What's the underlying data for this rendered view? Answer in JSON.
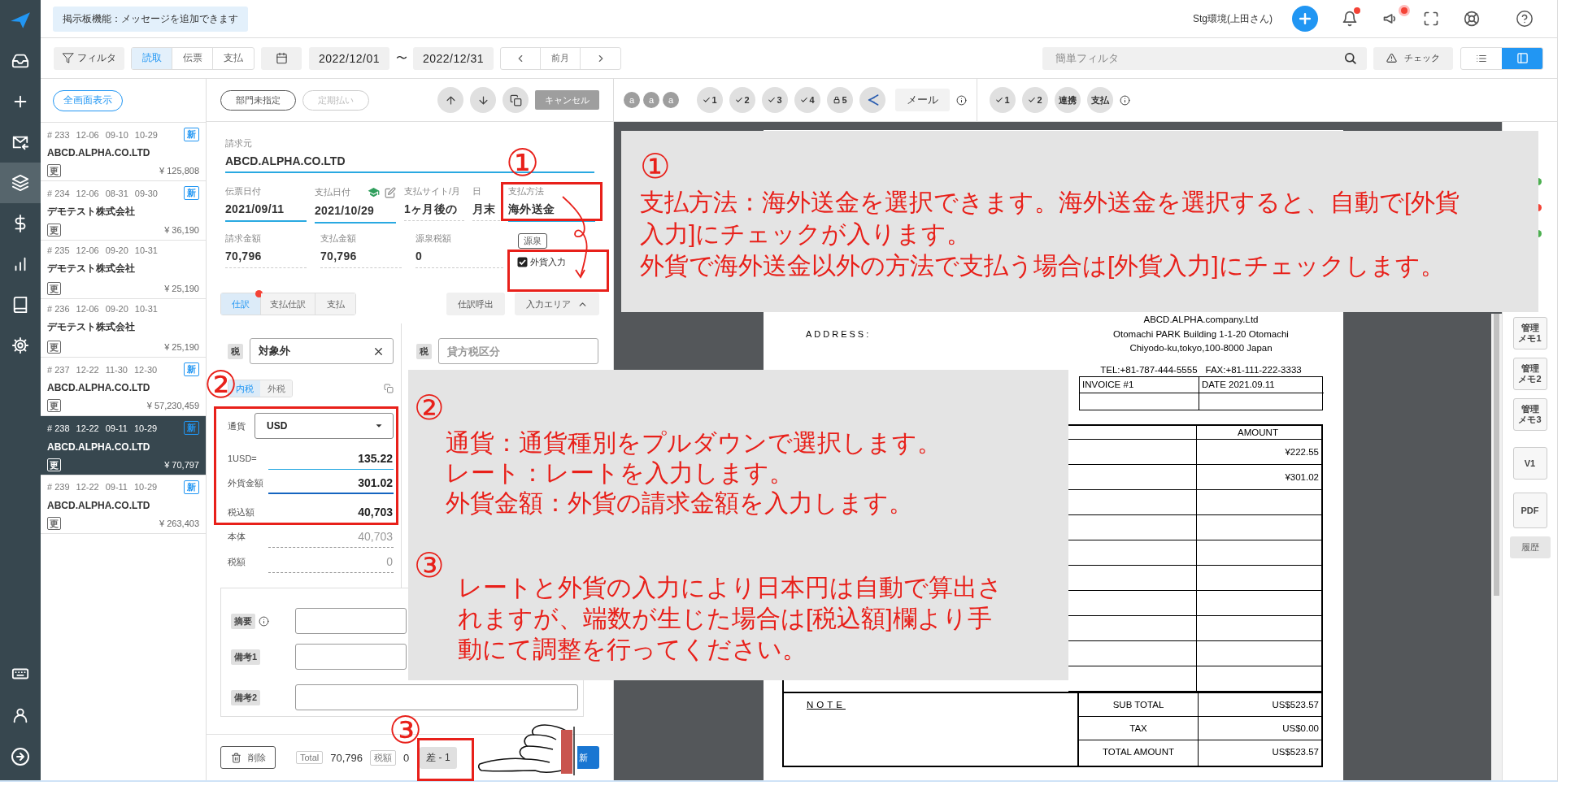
{
  "nav": {
    "items": [
      {
        "selected": false
      },
      {
        "selected": false
      },
      {
        "selected": false
      },
      {
        "selected": true
      },
      {
        "selected": false
      },
      {
        "selected": false
      },
      {
        "selected": false
      },
      {
        "selected": false
      }
    ]
  },
  "header": {
    "notice": "掲示板機能：メッセージを追加できます",
    "user": "Stg環境(上田さん)",
    "bell_alert": true,
    "announce_alert": true
  },
  "toolbar": {
    "filter": "フィルタ",
    "modes": [
      {
        "label": "読取",
        "selected": true
      },
      {
        "label": "伝票",
        "selected": false
      },
      {
        "label": "支払",
        "selected": false
      }
    ],
    "date_from": "2022/12/01",
    "range_sep": "〜",
    "date_to": "2022/12/31",
    "prev_month": "前月",
    "quick_filter": {
      "placeholder": "簡単フィルタ"
    },
    "check": "チェック",
    "views": [
      {
        "selected": false
      },
      {
        "selected": true
      }
    ]
  },
  "list": {
    "fullscreen": "全画面表示",
    "items": [
      {
        "no": "# 233",
        "dates": [
          "12-06",
          "09-10",
          "10-29"
        ],
        "new": "新",
        "vendor": "ABCD.ALPHA.CO.LTD",
        "tag": "更",
        "amount": "¥ 125,808",
        "selected": false
      },
      {
        "no": "# 234",
        "dates": [
          "12-06",
          "08-31",
          "09-30"
        ],
        "new": "新",
        "vendor": "デモテスト株式会社",
        "tag": "更",
        "amount": "¥ 36,190",
        "selected": false
      },
      {
        "no": "# 235",
        "dates": [
          "12-06",
          "09-20",
          "10-31"
        ],
        "vendor": "デモテスト株式会社",
        "tag": "更",
        "amount": "¥ 25,190",
        "selected": false
      },
      {
        "no": "# 236",
        "dates": [
          "12-06",
          "09-20",
          "10-31"
        ],
        "vendor": "デモテスト株式会社",
        "tag": "更",
        "amount": "¥ 25,190",
        "selected": false
      },
      {
        "no": "# 237",
        "dates": [
          "12-22",
          "11-30",
          "12-30"
        ],
        "new": "新",
        "vendor": "ABCD.ALPHA.CO.LTD",
        "tag": "更",
        "amount": "¥ 57,230,459",
        "selected": false
      },
      {
        "no": "# 238",
        "dates": [
          "12-22",
          "09-11",
          "10-29"
        ],
        "new": "新",
        "vendor": "ABCD.ALPHA.CO.LTD",
        "tag": "更",
        "amount": "¥ 70,797",
        "selected": true
      },
      {
        "no": "# 239",
        "dates": [
          "12-22",
          "09-11",
          "10-29"
        ],
        "new": "新",
        "vendor": "ABCD.ALPHA.CO.LTD",
        "tag": "更",
        "amount": "¥ 263,403",
        "selected": false
      }
    ]
  },
  "form": {
    "dept": "部門未指定",
    "recurring": {
      "label": "定期払い",
      "disabled": true
    },
    "cancel": "キャンセル",
    "vendor": {
      "label": "請求元",
      "value": "ABCD.ALPHA.CO.LTD"
    },
    "fields": [
      {
        "label": "伝票日付",
        "value": "2021/09/11",
        "kind": "input"
      },
      {
        "label": "支払日付",
        "value": "2021/10/29",
        "kind": "input-tools"
      },
      {
        "label": "支払サイト/月",
        "value": "1ヶ月後の",
        "kind": "static"
      },
      {
        "label": "日",
        "value": "月末",
        "kind": "static"
      },
      {
        "label": "支払方法",
        "value": "海外送金",
        "kind": "input"
      }
    ],
    "amounts": [
      {
        "label": "請求金額",
        "value": "70,796"
      },
      {
        "label": "支払金額",
        "value": "70,796"
      },
      {
        "label": "源泉税額",
        "value": "0"
      }
    ],
    "withholding": "源泉",
    "foreign": {
      "label": "外貨入力",
      "checked": true
    },
    "tabs": [
      {
        "label": "仕訳",
        "selected": true,
        "alert": true
      },
      {
        "label": "支払仕訳",
        "selected": false,
        "alert": false
      },
      {
        "label": "支払",
        "selected": false,
        "alert": false
      }
    ],
    "recall": "仕訳呼出",
    "input_area": "入力エリア",
    "tax_rows": [
      {
        "tag": "税",
        "value": "対象外"
      },
      {
        "tag": "税",
        "placeholder": "貸方税区分"
      }
    ],
    "tax_modes": [
      {
        "label": "内税",
        "selected": true
      },
      {
        "label": "外税",
        "selected": false
      }
    ],
    "currency": {
      "label": "通貨",
      "value": "USD"
    },
    "rate": {
      "label": "1USD=",
      "value": "135.22"
    },
    "fx_amount": {
      "label": "外貨金額",
      "value": "301.02"
    },
    "tax_incl": {
      "label": "税込額",
      "value": "40,703"
    },
    "body": {
      "label": "本体",
      "value": "40,703"
    },
    "tax": {
      "label": "税額",
      "value": "0"
    },
    "memos": [
      {
        "label": "摘要",
        "info": true
      },
      {
        "label": "備考1",
        "info": false
      },
      {
        "label": "備考2",
        "info": false
      }
    ],
    "footer": {
      "delete": "削除",
      "total_label": "Total",
      "total": "70,796",
      "tax_label": "税額",
      "tax": "0",
      "diff": "差 - 1",
      "submit": "新"
    }
  },
  "review": {
    "groups": [
      {
        "chips": [
          {
            "kind": "letter",
            "label": "a"
          },
          {
            "kind": "letter",
            "label": "a"
          },
          {
            "kind": "letter",
            "label": "a"
          },
          {
            "kind": "check",
            "label": "1"
          },
          {
            "kind": "check",
            "label": "2"
          },
          {
            "kind": "check",
            "label": "3"
          },
          {
            "kind": "check",
            "label": "4"
          },
          {
            "kind": "lock",
            "label": "5"
          },
          {
            "kind": "icon"
          }
        ],
        "mail": "メール"
      },
      {
        "chips": [
          {
            "kind": "check",
            "label": "1"
          },
          {
            "kind": "check",
            "label": "2"
          },
          {
            "kind": "text",
            "label": "連携"
          },
          {
            "kind": "text",
            "label": "支払"
          }
        ]
      }
    ]
  },
  "invoice": {
    "company": "ABCD.ALPHA.company.Ltd",
    "address_label": "ADDRESS:",
    "address_lines": [
      "Otomachi PARK Building 1-1-20 Otomachi",
      "Chiyodo-ku,tokyo,100-8000 Japan"
    ],
    "tel": "TEL:+81-787-444-5555",
    "fax": "FAX:+81-111-222-3333",
    "invoice_no": "INVOICE #1",
    "date": "DATE 2021.09.11",
    "amount_header": "AMOUNT",
    "amounts": [
      "¥222.55",
      "¥301.02"
    ],
    "note": "NOTE",
    "totals": [
      {
        "label": "SUB TOTAL",
        "value": "US$523.57"
      },
      {
        "label": "TAX",
        "value": "US$0.00"
      },
      {
        "label": "TOTAL AMOUNT",
        "value": "US$523.57"
      }
    ]
  },
  "sidebar": {
    "dots": [
      {
        "color": "#4caf50"
      },
      {
        "color": "#f44336"
      },
      {
        "color": "#4caf50"
      }
    ],
    "memos": [
      {
        "lines": [
          "管理",
          "メモ1"
        ]
      },
      {
        "lines": [
          "管理",
          "メモ2"
        ]
      },
      {
        "lines": [
          "管理",
          "メモ3"
        ]
      }
    ],
    "version": "V1",
    "pdf": "PDF",
    "history": "履歴"
  },
  "annotations": {
    "callouts": [
      {
        "sections": [
          {
            "number": "①",
            "lines": [
              "支払方法：海外送金を選択できます。海外送金を選択すると、自動で[外貨入力]にチェックが入ります。",
              "外貨で海外送金以外の方法で支払う場合は[外貨入力]にチェックします。"
            ]
          }
        ]
      },
      {
        "sections": [
          {
            "number": "②",
            "lines": [
              "通貨：通貨種別をプルダウンで選択します。",
              "レート：レートを入力します。",
              "外貨金額：外貨の請求金額を入力します。"
            ]
          },
          {
            "number": "③",
            "lines": [
              "レートと外貨の入力により日本円は自動で算出されますが、端数が生じた場合は[税込額]欄より手動にて調整を行ってください。"
            ]
          }
        ]
      }
    ],
    "markers": [
      "①",
      "②",
      "③"
    ]
  }
}
